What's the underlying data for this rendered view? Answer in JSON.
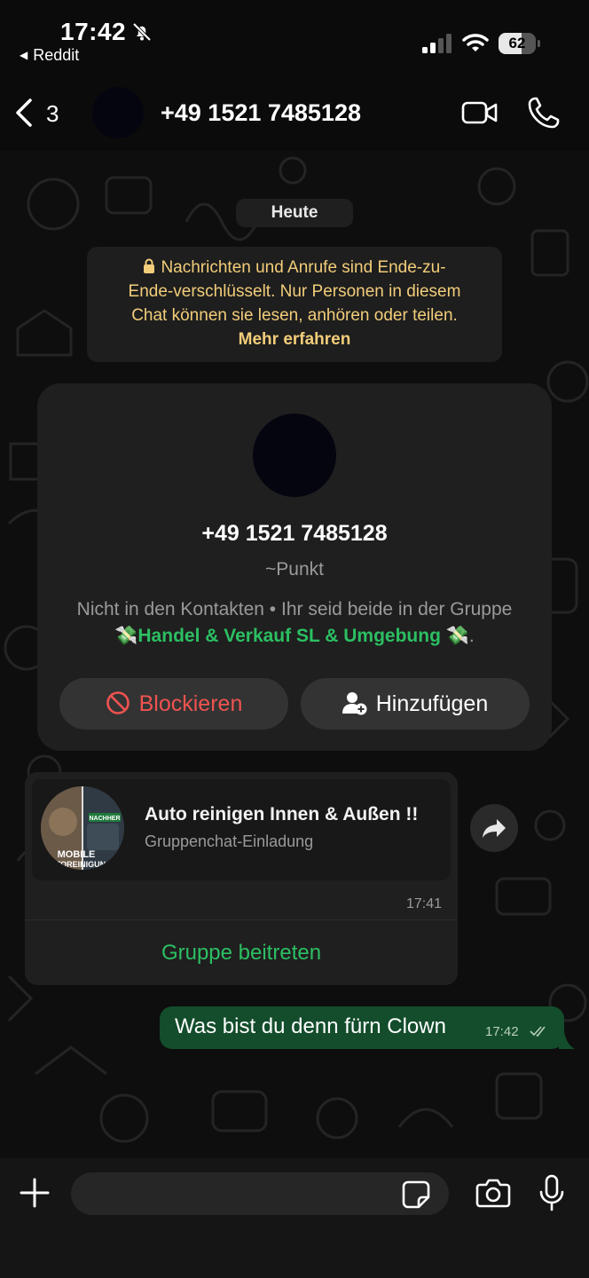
{
  "status_bar": {
    "time": "17:42",
    "back_app": "Reddit",
    "battery": "62",
    "battery_level": 0.62
  },
  "header": {
    "back_count": "3",
    "title": "+49 1521 7485128"
  },
  "chat": {
    "day_label": "Heute",
    "encryption_notice": {
      "line1": "Nachrichten und Anrufe sind Ende-zu-",
      "line2": "Ende-verschlüsselt. Nur Personen in diesem",
      "line3": "Chat können sie lesen, anhören oder teilen.",
      "learn_more": "Mehr erfahren"
    },
    "contact_card": {
      "phone": "+49 1521 7485128",
      "alias": "~Punkt",
      "info_line1": "Nicht in den Kontakten • Ihr seid beide in der Gruppe",
      "group_emoji_left": "💸",
      "group_name": "Handel & Verkauf SL & Umgebung",
      "group_emoji_right": "💸",
      "group_suffix": ".",
      "block_label": "Blockieren",
      "add_label": "Hinzufügen"
    },
    "group_invite": {
      "title": "Auto reinigen Innen & Außen !!",
      "subtitle": "Gruppenchat-Einladung",
      "time": "17:41",
      "join_label": "Gruppe beitreten",
      "avatar_badge_top": "NACHHER",
      "avatar_badge_bottom1": "MOBILE",
      "avatar_badge_bottom2": "AUTOREINIGUNG"
    },
    "outgoing_message": {
      "text": "Was bist du denn fürn Clown",
      "time": "17:42"
    }
  },
  "composer": {
    "placeholder": ""
  },
  "colors": {
    "accent_green": "#2cbf62",
    "outgoing_bubble": "#134d2c",
    "block_red": "#ef5350",
    "notice_yellow": "#f2cd7a"
  },
  "icons": [
    "bell-slash-icon",
    "signal-icon",
    "wifi-icon",
    "battery-icon",
    "chevron-left-icon",
    "video-call-icon",
    "phone-call-icon",
    "lock-icon",
    "block-icon",
    "add-contact-icon",
    "forward-icon",
    "double-check-icon",
    "plus-icon",
    "sticker-icon",
    "camera-icon",
    "microphone-icon"
  ]
}
